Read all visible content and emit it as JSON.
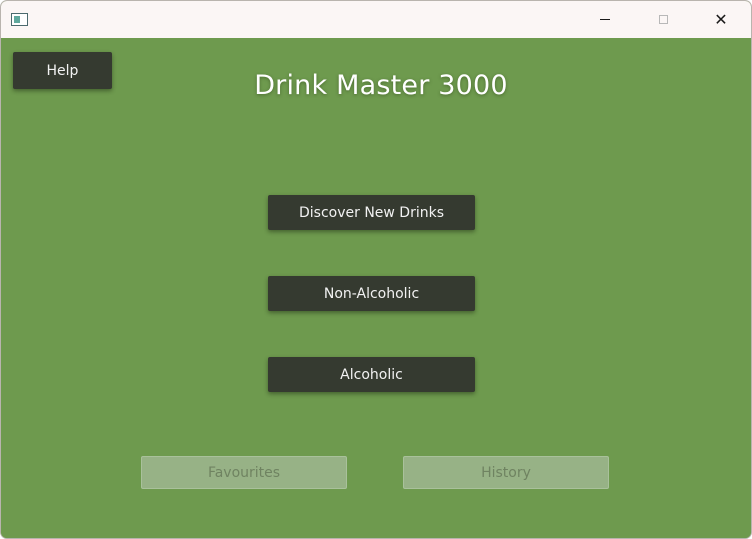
{
  "window": {
    "minimize_icon": "minimize-icon",
    "maximize_icon": "maximize-icon",
    "close_glyph": "✕",
    "app_icon": "window-app-icon"
  },
  "main": {
    "title": "Drink Master 3000",
    "help_label": "Help",
    "discover_label": "Discover New Drinks",
    "non_alcoholic_label": "Non-Alcoholic",
    "alcoholic_label": "Alcoholic",
    "favourites_label": "Favourites",
    "history_label": "History"
  },
  "colors": {
    "background": "#6e9a4e",
    "button": "#353a30",
    "button_text": "#f2f2f2",
    "disabled_button": "#97b286",
    "disabled_text": "#6f8361",
    "titlebar": "#fbf6f5"
  }
}
